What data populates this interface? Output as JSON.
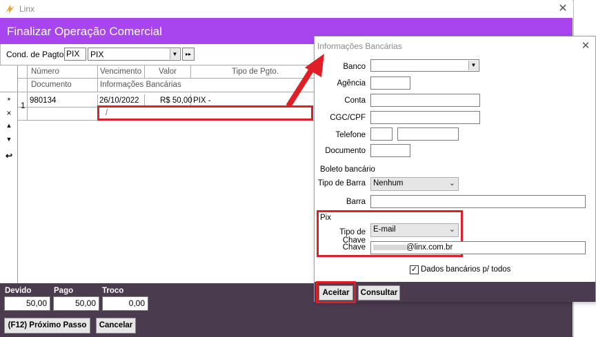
{
  "window": {
    "app_title": "Linx",
    "close": "✕"
  },
  "header": {
    "title": "Finalizar Operação Comercial"
  },
  "payment": {
    "cond_label": "Cond. de Pagto",
    "cond_code": "PIX",
    "cond_value": "PIX",
    "next_label": "▸▸"
  },
  "grid": {
    "headers_row1": [
      "Número",
      "Vencimento",
      "Valor",
      "Tipo de Pgto."
    ],
    "headers_row2": [
      "Documento",
      "Informações Bancárias"
    ],
    "row_num": "1",
    "row": {
      "numero": "980134",
      "vencimento": "26/10/2022",
      "valor": "R$ 50,00",
      "tipo": "PIX -",
      "info": "/"
    },
    "row_icons": [
      "*",
      "×",
      "▲",
      "▼",
      "↩"
    ]
  },
  "totals": {
    "devido_label": "Devido",
    "devido_value": "50,00",
    "pago_label": "Pago",
    "pago_value": "50,00",
    "troco_label": "Troco",
    "troco_value": "0,00"
  },
  "buttons": {
    "next_step": "(F12) Próximo Passo",
    "cancel": "Cancelar"
  },
  "dialog": {
    "title": "Informações Bancárias",
    "close": "✕",
    "banco_label": "Banco",
    "agencia_label": "Agência",
    "conta_label": "Conta",
    "cgc_label": "CGC/CPF",
    "telefone_label": "Telefone",
    "documento_label": "Documento",
    "boleto_section": "Boleto bancário",
    "tipo_barra_label": "Tipo de Barra",
    "tipo_barra_value": "Nenhum",
    "barra_label": "Barra",
    "pix_section": "Pix",
    "tipo_chave_label": "Tipo de Chave",
    "tipo_chave_value": "E-mail",
    "chave_label": "Chave",
    "chave_value": "@linx.com.br",
    "dados_todos_label": "Dados bancários p/ todos",
    "dados_todos_checked": true,
    "aceitar": "Aceitar",
    "consultar": "Consultar"
  },
  "colors": {
    "header": "#a845ee",
    "panel": "#4a3c4e",
    "highlight": "#e01e26"
  }
}
